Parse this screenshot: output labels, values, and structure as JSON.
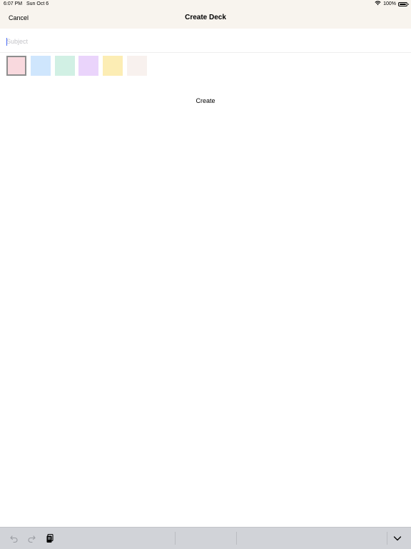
{
  "status_bar": {
    "time": "6:07 PM",
    "date": "Sun Oct 6",
    "battery_text": "100%",
    "battery_level": 1.0,
    "icons": [
      "wifi-icon",
      "battery-icon"
    ]
  },
  "nav": {
    "cancel_label": "Cancel",
    "title": "Create Deck"
  },
  "form": {
    "subject_placeholder": "Subject",
    "subject_value": "",
    "create_label": "Create"
  },
  "colors": {
    "header_bg": "#f8f4ee",
    "swatches": [
      "#f9d9de",
      "#cfe6fd",
      "#d1f0e4",
      "#ead4fb",
      "#fcedb4",
      "#f8f1ee"
    ],
    "selected_swatch_index": 0,
    "keyboard_bar_bg": "#d1d3d8"
  },
  "keyboard_bar": {
    "icons": [
      "undo-icon",
      "redo-icon",
      "paste-icon",
      "chevron-down-icon"
    ]
  }
}
